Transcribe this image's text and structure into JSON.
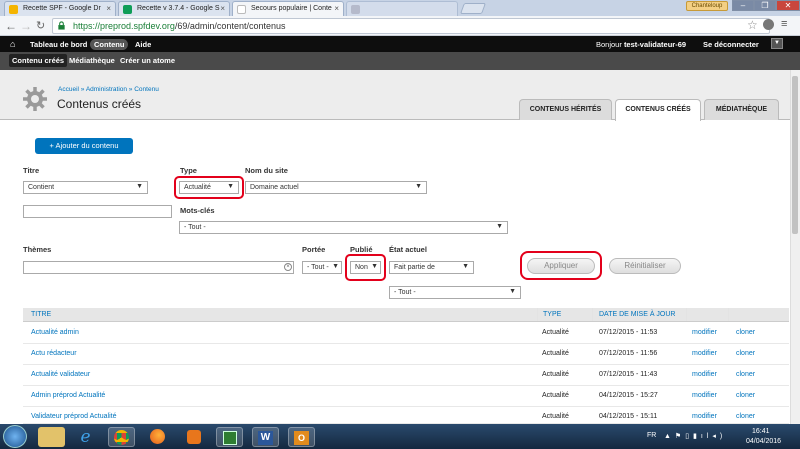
{
  "browser": {
    "tabs": [
      {
        "label": "Recette SPF - Google Dr"
      },
      {
        "label": "Recette v 3.7.4 - Google S"
      },
      {
        "label": "Secours populaire | Conte"
      },
      {
        "label": ""
      }
    ],
    "user_chip": "Chanteloup",
    "url_host": "https://preprod.spfdev.org",
    "url_path": "/69/admin/content/contenus"
  },
  "adminbar": {
    "home_icon": "home-icon",
    "items": [
      "Tableau de bord",
      "Contenu",
      "Aide"
    ],
    "greeting_prefix": "Bonjour ",
    "username": "test-validateur-69",
    "logout": "Se déconnecter"
  },
  "shortcuts": [
    "Contenu créés",
    "Médiathèque",
    "Créer un atome"
  ],
  "header": {
    "breadcrumb": "Accueil » Administration » Contenu",
    "title": "Contenus créés",
    "tabs": [
      "CONTENUS HÉRITÉS",
      "CONTENUS CRÉÉS",
      "MÉDIATHÈQUE"
    ]
  },
  "filters": {
    "add_button": "+ Ajouter du contenu",
    "titre_label": "Titre",
    "titre_op": "Contient",
    "type_label": "Type",
    "type_value": "Actualité",
    "site_label": "Nom du site",
    "site_value": "Domaine actuel",
    "motscles_label": "Mots-clés",
    "motscles_value": "- Tout -",
    "themes_label": "Thèmes",
    "portee_label": "Portée",
    "portee_value": "- Tout -",
    "publie_label": "Publié",
    "publie_value": "Non",
    "etat_label": "État actuel",
    "etat_value": "Fait partie de",
    "etat_sub_value": "- Tout -",
    "apply": "Appliquer",
    "reset": "Réinitialiser"
  },
  "table": {
    "headers": [
      "TITRE",
      "TYPE",
      "DATE DE MISE À JOUR"
    ],
    "rows": [
      {
        "title": "Actualité admin",
        "type": "Actualité",
        "date": "07/12/2015 - 11:53",
        "edit": "modifier",
        "clone": "cloner"
      },
      {
        "title": "Actu rédacteur",
        "type": "Actualité",
        "date": "07/12/2015 - 11:56",
        "edit": "modifier",
        "clone": "cloner"
      },
      {
        "title": "Actualité validateur",
        "type": "Actualité",
        "date": "07/12/2015 - 11:43",
        "edit": "modifier",
        "clone": "cloner"
      },
      {
        "title": "Admin préprod Actualité",
        "type": "Actualité",
        "date": "04/12/2015 - 15:27",
        "edit": "modifier",
        "clone": "cloner"
      },
      {
        "title": "Validateur préprod Actualité",
        "type": "Actualité",
        "date": "04/12/2015 - 15:11",
        "edit": "modifier",
        "clone": "cloner"
      }
    ]
  },
  "taskbar": {
    "lang": "FR",
    "time": "16:41",
    "date": "04/04/2016"
  }
}
